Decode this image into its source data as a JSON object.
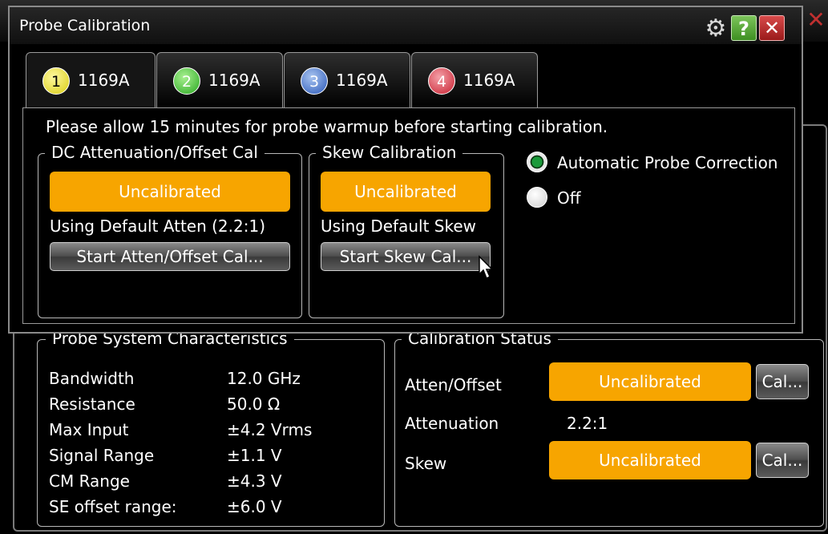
{
  "background": {
    "close_glyph": "✕",
    "characteristics": {
      "title": "Probe System Characteristics",
      "rows": [
        {
          "label": "Bandwidth",
          "value": "12.0 GHz"
        },
        {
          "label": "Resistance",
          "value": "50.0 Ω"
        },
        {
          "label": "Max Input",
          "value": "±4.2 Vrms"
        },
        {
          "label": "Signal Range",
          "value": "±1.1 V"
        },
        {
          "label": "CM Range",
          "value": "±4.3 V"
        },
        {
          "label": "SE offset range:",
          "value": "±6.0 V"
        }
      ]
    },
    "calibration_status": {
      "title": "Calibration Status",
      "atten_offset_label": "Atten/Offset",
      "atten_offset_status": "Uncalibrated",
      "atten_offset_button": "Cal...",
      "attenuation_label": "Attenuation",
      "attenuation_value": "2.2:1",
      "skew_label": "Skew",
      "skew_status": "Uncalibrated",
      "skew_button": "Cal..."
    }
  },
  "dialog": {
    "title": "Probe Calibration",
    "icons": {
      "settings": "gear-icon",
      "help": "help-icon",
      "close": "close-icon"
    },
    "help_glyph": "?",
    "close_glyph": "✕",
    "gear_glyph": "⚙",
    "tabs": [
      {
        "number": "1",
        "label": "1169A",
        "color": "#e8e020",
        "active": true
      },
      {
        "number": "2",
        "label": "1169A",
        "color": "#38c030",
        "active": false
      },
      {
        "number": "3",
        "label": "1169A",
        "color": "#3a6ec8",
        "active": false
      },
      {
        "number": "4",
        "label": "1169A",
        "color": "#d83040",
        "active": false
      }
    ],
    "warmup_text": "Please allow 15 minutes for probe warmup before starting calibration.",
    "dc_group": {
      "title": "DC Attenuation/Offset Cal",
      "status": "Uncalibrated",
      "info": "Using Default Atten (2.2:1)",
      "button": "Start Atten/Offset Cal..."
    },
    "skew_group": {
      "title": "Skew Calibration",
      "status": "Uncalibrated",
      "info": "Using Default Skew",
      "button": "Start Skew Cal..."
    },
    "correction": {
      "automatic_label": "Automatic Probe Correction",
      "off_label": "Off",
      "selected": "automatic"
    }
  },
  "colors": {
    "uncalibrated": "#f7a500",
    "selected_radio": "#1a9a3a"
  }
}
